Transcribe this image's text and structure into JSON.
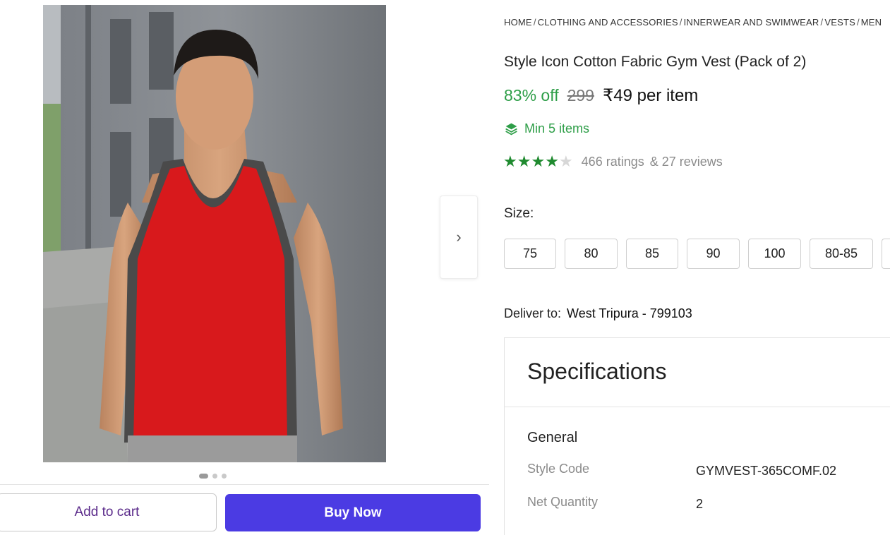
{
  "breadcrumb": [
    "HOME",
    "CLOTHING AND ACCESSORIES",
    "INNERWEAR AND SWIMWEAR",
    "VESTS",
    "MEN"
  ],
  "product": {
    "title": "Style Icon Cotton Fabric Gym Vest (Pack of 2)",
    "discount": "83% off",
    "mrp": "299",
    "price": "₹49 per item",
    "min_items": "Min 5 items",
    "rating_stars": 4,
    "rating_max": 5,
    "ratings_text": "466 ratings",
    "reviews_text": "& 27 reviews"
  },
  "size": {
    "label": "Size:",
    "options": [
      "75",
      "80",
      "85",
      "90",
      "100",
      "80-85"
    ]
  },
  "delivery": {
    "label": "Deliver to:",
    "location": "West Tripura - 799103"
  },
  "specs": {
    "title": "Specifications",
    "section": "General",
    "rows": [
      {
        "key": "Style Code",
        "value": "GYMVEST-365COMF.02"
      },
      {
        "key": "Net Quantity",
        "value": "2"
      }
    ]
  },
  "gallery": {
    "total_images": 3,
    "active_index": 0,
    "next_icon": "chevron-right-icon"
  },
  "actions": {
    "add_to_cart": "Add to cart",
    "buy_now": "Buy Now"
  },
  "colors": {
    "discount_green": "#2e9e48",
    "star_green": "#1f8a2f",
    "buy_button": "#4b3be3",
    "vest_red": "#d8191c"
  }
}
